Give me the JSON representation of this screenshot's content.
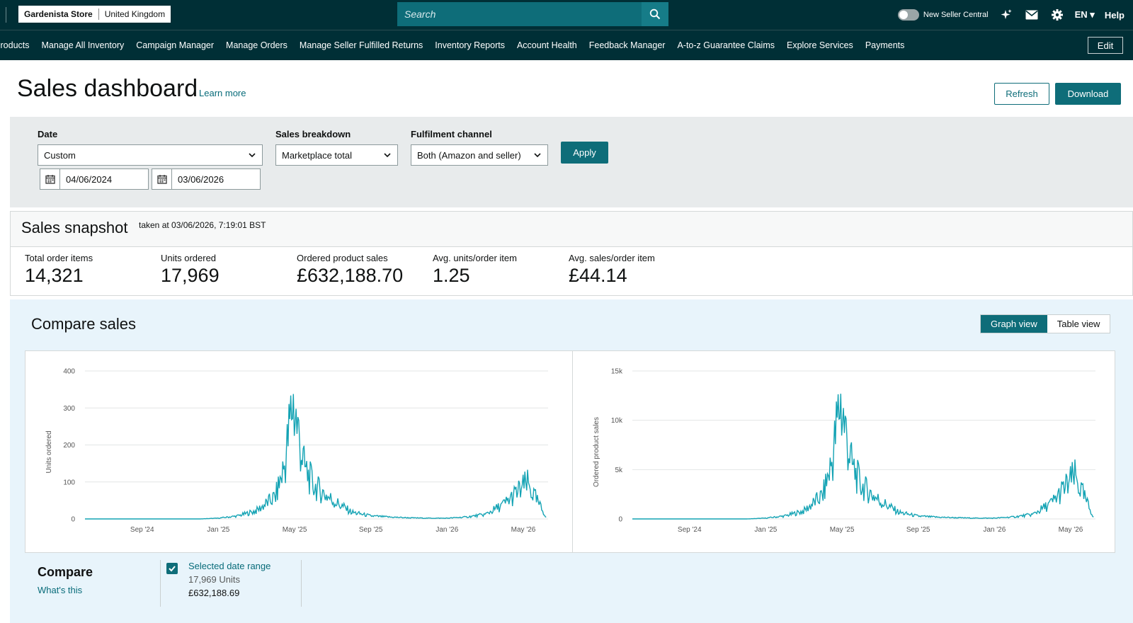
{
  "topbar": {
    "store_name": "Gardenista Store",
    "store_region": "United Kingdom",
    "search_placeholder": "Search",
    "new_seller_central": "New Seller Central",
    "language": "EN",
    "help": "Help"
  },
  "nav": {
    "items": [
      "roducts",
      "Manage All Inventory",
      "Campaign Manager",
      "Manage Orders",
      "Manage Seller Fulfilled Returns",
      "Inventory Reports",
      "Account Health",
      "Feedback Manager",
      "A-to-z Guarantee Claims",
      "Explore Services",
      "Payments"
    ],
    "edit": "Edit"
  },
  "header": {
    "title": "Sales dashboard",
    "learn_more": "Learn more",
    "refresh": "Refresh",
    "download": "Download"
  },
  "filters": {
    "date_label": "Date",
    "date_value": "Custom",
    "breakdown_label": "Sales breakdown",
    "breakdown_value": "Marketplace total",
    "channel_label": "Fulfilment channel",
    "channel_value": "Both (Amazon and seller)",
    "apply": "Apply",
    "start_date": "04/06/2024",
    "end_date": "03/06/2026"
  },
  "snapshot": {
    "title": "Sales snapshot",
    "taken": "taken at 03/06/2026, 7:19:01 BST",
    "metrics": [
      {
        "label": "Total order items",
        "value": "14,321"
      },
      {
        "label": "Units ordered",
        "value": "17,969"
      },
      {
        "label": "Ordered product sales",
        "value": "£632,188.70"
      },
      {
        "label": "Avg. units/order item",
        "value": "1.25"
      },
      {
        "label": "Avg. sales/order item",
        "value": "£44.14"
      }
    ]
  },
  "compare": {
    "title": "Compare sales",
    "graph_view": "Graph view",
    "table_view": "Table view",
    "footer_title": "Compare",
    "whats_this": "What's this",
    "range_label": "Selected date range",
    "range_units": "17,969 Units",
    "range_sales": "£632,188.69"
  },
  "colors": {
    "header_bg": "#002f36",
    "accent": "#0e6d79",
    "line": "#14a3b4"
  },
  "chart_data": [
    {
      "type": "line",
      "ylabel": "Units ordered",
      "x_ticks": [
        "Sep '24",
        "Jan '25",
        "May '25",
        "Sep '25",
        "Jan '26",
        "May '26"
      ],
      "y_ticks": [
        "0",
        "100",
        "200",
        "300",
        "400"
      ],
      "ylim": [
        0,
        400
      ],
      "grid": true,
      "series": [
        {
          "x": [
            "Jun '24",
            "Jul '24",
            "Aug '24",
            "Sep '24",
            "Oct '24",
            "Nov '24",
            "Dec '24",
            "Jan '25",
            "Feb '25",
            "Mar '25",
            "Apr '25",
            "Apr '25 (late)",
            "May '25",
            "May '25 (mid)",
            "Jun '25",
            "Jul '25",
            "Aug '25",
            "Sep '25",
            "Oct '25",
            "Nov '25",
            "Dec '25",
            "Jan '26",
            "Feb '26",
            "Mar '26",
            "Apr '26",
            "May '26",
            "Jun '26"
          ],
          "values": [
            0,
            0,
            0,
            0,
            0,
            0,
            0,
            2,
            8,
            22,
            60,
            150,
            320,
            140,
            90,
            50,
            18,
            8,
            5,
            3,
            2,
            2,
            5,
            12,
            40,
            95,
            5
          ]
        }
      ]
    },
    {
      "type": "line",
      "ylabel": "Ordered product sales",
      "x_ticks": [
        "Sep '24",
        "Jan '25",
        "May '25",
        "Sep '25",
        "Jan '26",
        "May '26"
      ],
      "y_ticks": [
        "0",
        "5k",
        "10k",
        "15k"
      ],
      "ylim": [
        0,
        15000
      ],
      "grid": true,
      "series": [
        {
          "x": [
            "Jun '24",
            "Jul '24",
            "Aug '24",
            "Sep '24",
            "Oct '24",
            "Nov '24",
            "Dec '24",
            "Jan '25",
            "Feb '25",
            "Mar '25",
            "Apr '25",
            "Apr '25 (late)",
            "May '25",
            "May '25 (mid)",
            "Jun '25",
            "Jul '25",
            "Aug '25",
            "Sep '25",
            "Oct '25",
            "Nov '25",
            "Dec '25",
            "Jan '26",
            "Feb '26",
            "Mar '26",
            "Apr '26",
            "May '26",
            "Jun '26"
          ],
          "values": [
            0,
            0,
            0,
            0,
            0,
            0,
            0,
            80,
            300,
            800,
            2400,
            6000,
            12000,
            5500,
            3400,
            1800,
            650,
            280,
            180,
            120,
            80,
            80,
            200,
            450,
            1600,
            4300,
            200
          ]
        }
      ]
    }
  ]
}
